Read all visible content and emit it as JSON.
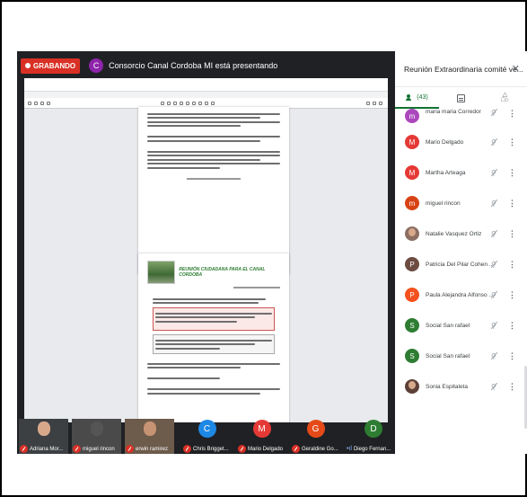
{
  "meeting": {
    "recording_label": "GRABANDO",
    "presenter_initial": "C",
    "presenter_color": "#8e24aa",
    "presenting_text": "Consorcio Canal Cordoba MI está presentando"
  },
  "shared_doc": {
    "page2_heading": "REUNIÓN CIUDADANA PARA EL CANAL CORDOBA"
  },
  "panel": {
    "title": "Reunión Extraordinaria comité ve...",
    "people_count": "(43)",
    "participants": [
      {
        "initial": "m",
        "name": "maria maria Corredor",
        "color": "#ab47bc"
      },
      {
        "initial": "M",
        "name": "Mario Delgado",
        "color": "#e53935"
      },
      {
        "initial": "M",
        "name": "Martha Arteaga",
        "color": "#e53935"
      },
      {
        "initial": "m",
        "name": "miguel rincon",
        "color": "#d84315"
      },
      {
        "initial": "",
        "name": "Natalie Vasquez Ortiz",
        "color": "#8d6e63",
        "photo": true
      },
      {
        "initial": "P",
        "name": "Patricia Del Pilar Cohen ...",
        "color": "#6d4c41"
      },
      {
        "initial": "P",
        "name": "Paula Alejandra Alfonso ...",
        "color": "#f4511e"
      },
      {
        "initial": "S",
        "name": "Social San rafael",
        "color": "#2e7d32"
      },
      {
        "initial": "S",
        "name": "Social San rafael",
        "color": "#2e7d32"
      },
      {
        "initial": "",
        "name": "Sonia Espitaleta",
        "color": "#8d6e63",
        "photo": true
      }
    ]
  },
  "strip": [
    {
      "name": "Adriana Mor...",
      "initial": "",
      "color": "#3c4043",
      "photo": true,
      "muted": true
    },
    {
      "name": "miguel rincon",
      "initial": "",
      "color": "#3c4043",
      "photo": true,
      "muted": true
    },
    {
      "name": "erwin ramirez",
      "initial": "",
      "color": "#3c4043",
      "photo": true,
      "muted": true
    },
    {
      "name": "Chris Brigget...",
      "initial": "C",
      "color": "#1e88e5",
      "muted": true
    },
    {
      "name": "Mario Delgado",
      "initial": "M",
      "color": "#e53935",
      "muted": true
    },
    {
      "name": "Geraldine Go...",
      "initial": "G",
      "color": "#e64a19",
      "muted": true
    },
    {
      "name": "Diego Fernan...",
      "initial": "D",
      "color": "#2e7d32",
      "muted": false
    }
  ]
}
